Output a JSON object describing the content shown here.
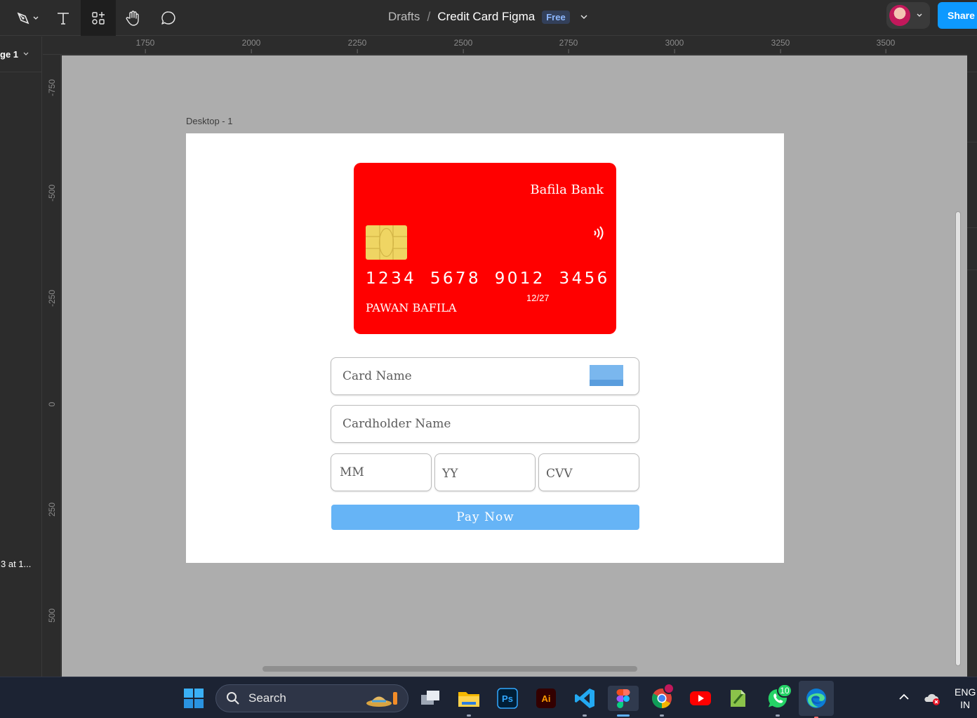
{
  "toolbar": {
    "breadcrumb_folder": "Drafts",
    "breadcrumb_separator": "/",
    "file_name": "Credit Card Figma",
    "plan_badge": "Free",
    "share_label": "Share",
    "tools": [
      "pen-tool-icon",
      "text-tool-icon",
      "components-tool-icon",
      "hand-tool-icon",
      "comment-tool-icon"
    ]
  },
  "left_panel": {
    "page_label": "ge 1",
    "layer_label": "3 at 1..."
  },
  "rulers": {
    "top": [
      "1750",
      "2000",
      "2250",
      "2500",
      "2750",
      "3000",
      "3250",
      "3500"
    ],
    "left": [
      "-750",
      "-500",
      "-250",
      "0",
      "250",
      "500"
    ]
  },
  "canvas": {
    "background": "#adadad",
    "frame_label": "Desktop - 1",
    "card": {
      "color": "#ff0000",
      "bank_name": "Bafila Bank",
      "number": "1234 5678 9012 3456",
      "expiry": "12/27",
      "holder": "PAWAN BAFILA"
    },
    "form": {
      "card_name_placeholder": "Card Name",
      "cardholder_placeholder": "Cardholder Name",
      "mm_placeholder": "MM",
      "yy_placeholder": "YY",
      "cvv_placeholder": "CVV",
      "pay_label": "Pay Now",
      "pay_color": "#66b4f6"
    }
  },
  "taskbar": {
    "search_label": "Search",
    "apps": [
      "start-icon",
      "task-view-icon",
      "file-explorer-icon",
      "photoshop-icon",
      "illustrator-icon",
      "vscode-icon",
      "figma-icon",
      "chrome-icon",
      "youtube-icon",
      "notepad-plus-plus-icon",
      "whatsapp-icon",
      "edge-icon"
    ],
    "whatsapp_badge": "10",
    "lang_line1": "ENG",
    "lang_line2": "IN"
  }
}
